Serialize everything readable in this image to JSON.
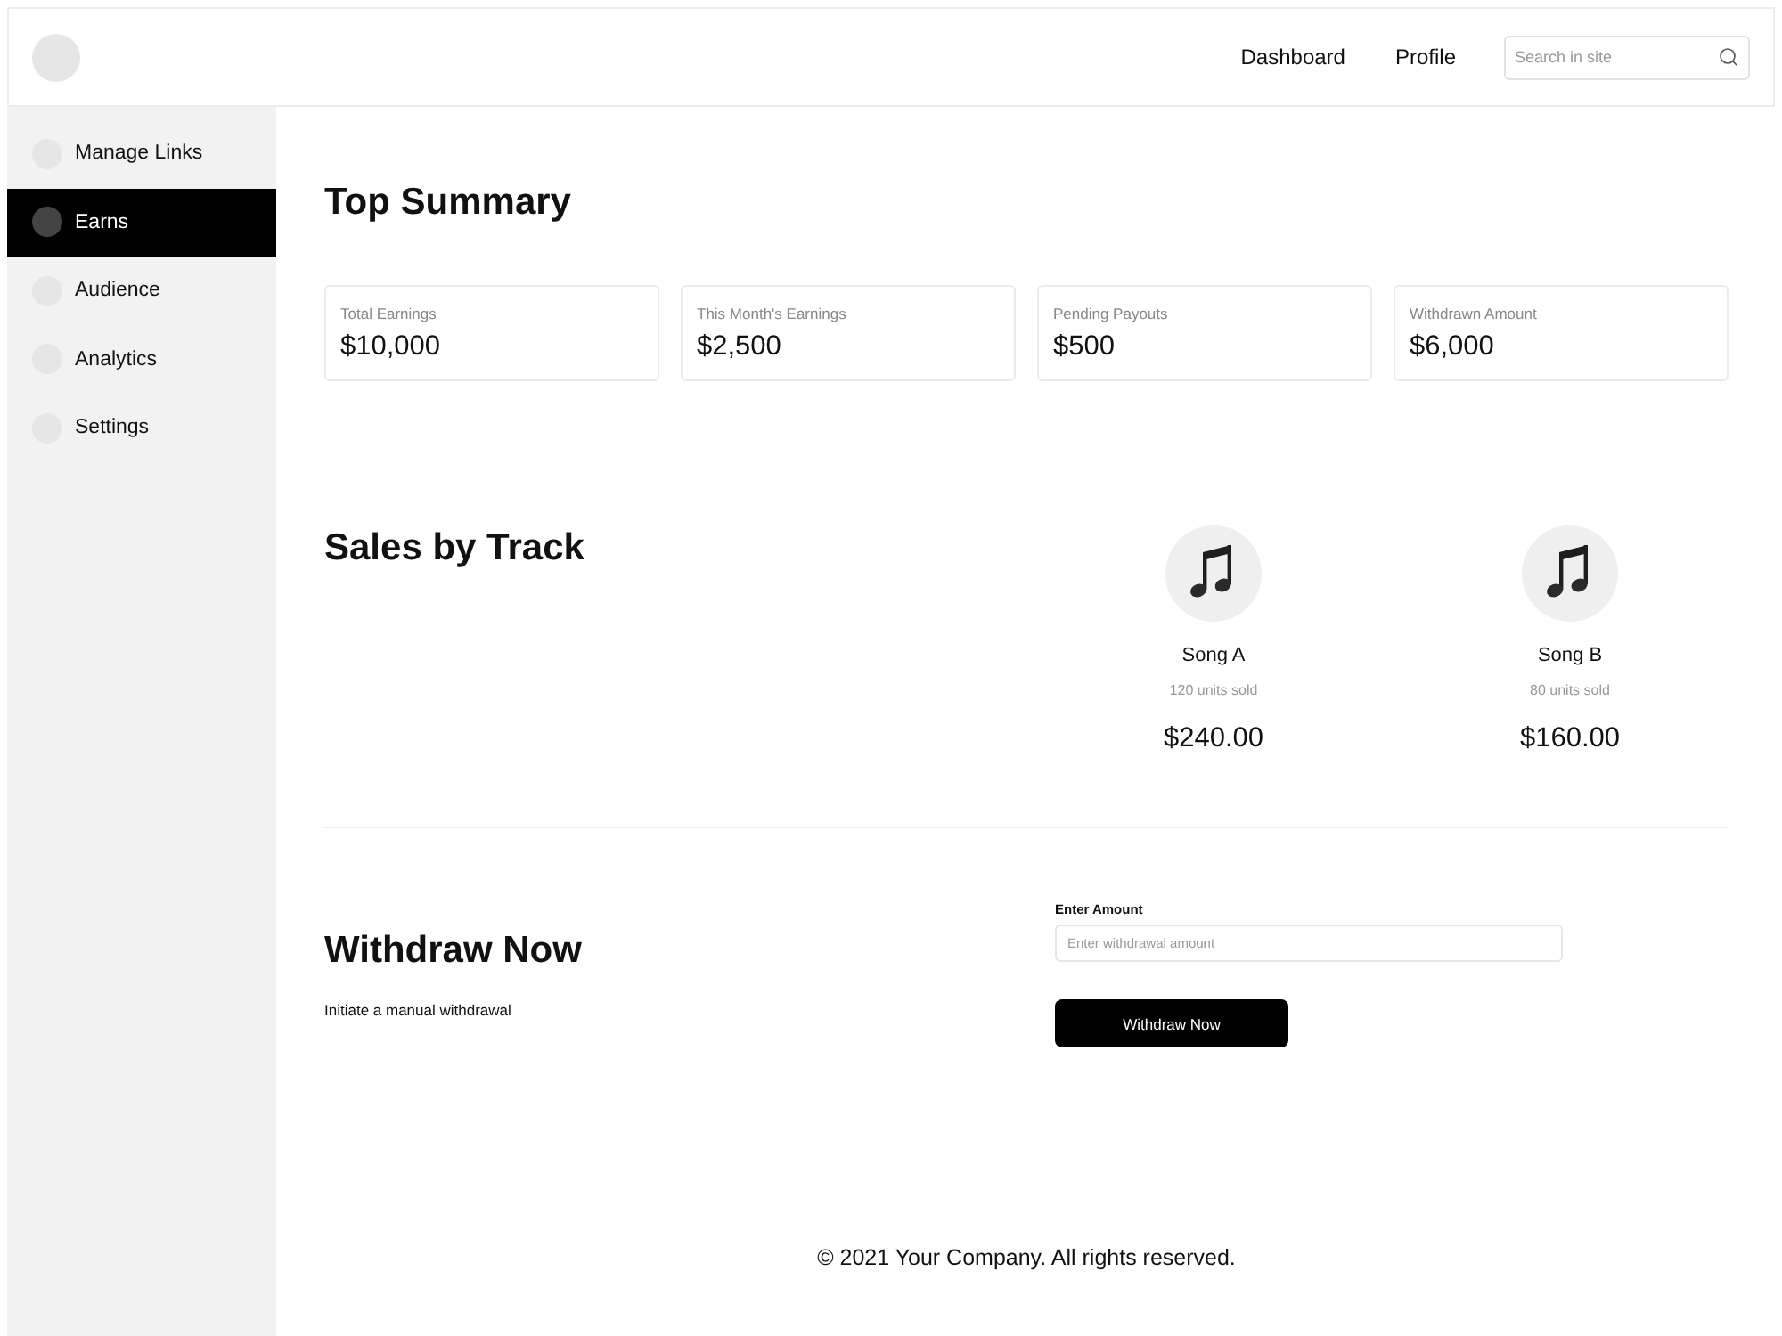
{
  "header": {
    "nav_links": [
      {
        "label": "Dashboard"
      },
      {
        "label": "Profile"
      }
    ],
    "search": {
      "placeholder": "Search in site"
    }
  },
  "sidebar": {
    "items": [
      {
        "label": "Manage Links",
        "selected": false
      },
      {
        "label": "Earns",
        "selected": true
      },
      {
        "label": "Audience",
        "selected": false
      },
      {
        "label": "Analytics",
        "selected": false
      },
      {
        "label": "Settings",
        "selected": false
      }
    ]
  },
  "summary": {
    "title": "Top Summary",
    "cards": [
      {
        "label": "Total Earnings",
        "value": "$10,000"
      },
      {
        "label": "This Month's Earnings",
        "value": "$2,500"
      },
      {
        "label": "Pending Payouts",
        "value": "$500"
      },
      {
        "label": "Withdrawn Amount",
        "value": "$6,000"
      }
    ]
  },
  "sales": {
    "title": "Sales by Track",
    "tracks": [
      {
        "name": "Song A",
        "units": "120 units sold",
        "amount": "$240.00"
      },
      {
        "name": "Song B",
        "units": "80 units sold",
        "amount": "$160.00"
      }
    ]
  },
  "withdraw": {
    "title": "Withdraw Now",
    "subtitle": "Initiate a manual withdrawal",
    "field_label": "Enter Amount",
    "placeholder": "Enter withdrawal amount",
    "button": "Withdraw Now"
  },
  "footer": {
    "text": "© 2021 Your Company. All rights reserved."
  }
}
